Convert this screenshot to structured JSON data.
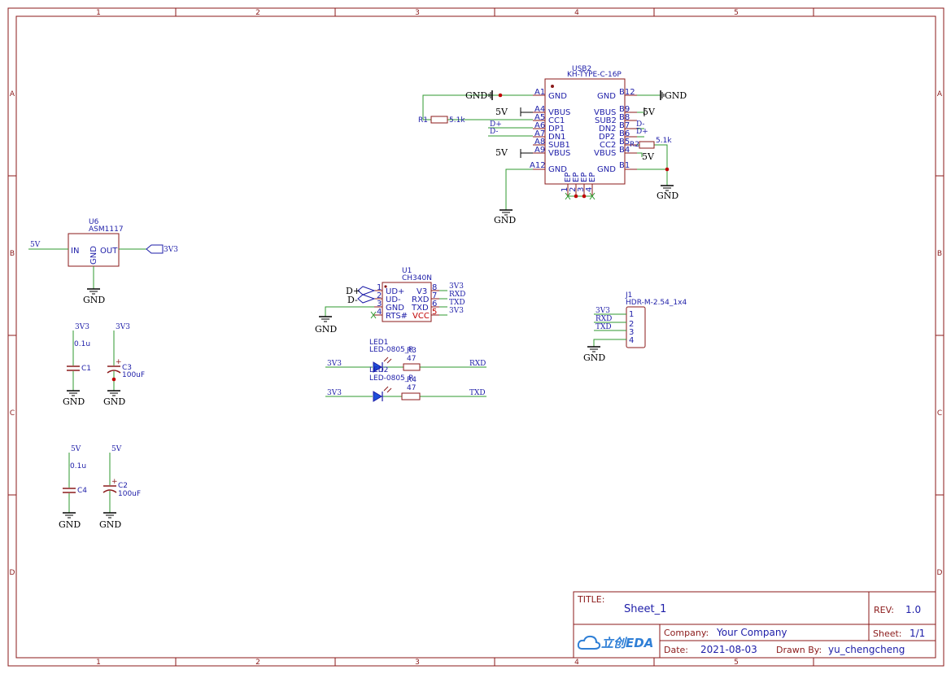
{
  "frame": {
    "columns": [
      "1",
      "2",
      "3",
      "4",
      "5"
    ],
    "rows": [
      "A",
      "B",
      "C",
      "D"
    ]
  },
  "usb2": {
    "ref": "USB2",
    "value": "KH-TYPE-C-16P",
    "left_pins": [
      {
        "num": "A1",
        "name": "GND"
      },
      {
        "num": "A4",
        "name": "VBUS"
      },
      {
        "num": "A5",
        "name": "CC1"
      },
      {
        "num": "A6",
        "name": "DP1"
      },
      {
        "num": "A7",
        "name": "DN1"
      },
      {
        "num": "A8",
        "name": "SUB1"
      },
      {
        "num": "A9",
        "name": "VBUS"
      },
      {
        "num": "A12",
        "name": "GND"
      }
    ],
    "right_pins": [
      {
        "num": "B12",
        "name": "GND"
      },
      {
        "num": "B9",
        "name": "VBUS"
      },
      {
        "num": "B8",
        "name": "SUB2"
      },
      {
        "num": "B7",
        "name": "DN2"
      },
      {
        "num": "B6",
        "name": "DP2"
      },
      {
        "num": "B5",
        "name": "CC2"
      },
      {
        "num": "B4",
        "name": "VBUS"
      },
      {
        "num": "B1",
        "name": "GND"
      }
    ],
    "bottom_pins": [
      "EP",
      "EP",
      "EP",
      "EP"
    ],
    "bottom_nums": [
      "1",
      "2",
      "3",
      "4"
    ]
  },
  "r1": {
    "ref": "R1",
    "value": "5.1k"
  },
  "r2": {
    "ref": "R2",
    "value": "5.1k"
  },
  "u6": {
    "ref": "U6",
    "value": "ASM1117",
    "pin_in": "IN",
    "pin_out": "OUT",
    "pin_gnd": "GND"
  },
  "u1": {
    "ref": "U1",
    "value": "CH340N",
    "left_pins": [
      {
        "num": "1",
        "name": "UD+"
      },
      {
        "num": "2",
        "name": "UD-"
      },
      {
        "num": "3",
        "name": "GND"
      },
      {
        "num": "4",
        "name": "RTS#"
      }
    ],
    "right_pins": [
      {
        "num": "8",
        "name": "V3"
      },
      {
        "num": "7",
        "name": "RXD"
      },
      {
        "num": "6",
        "name": "TXD"
      },
      {
        "num": "5",
        "name": "VCC"
      }
    ]
  },
  "j1": {
    "ref": "J1",
    "value": "HDR-M-2.54_1x4",
    "pins": [
      "1",
      "2",
      "3",
      "4"
    ]
  },
  "led1": {
    "ref": "LED1",
    "value": "LED-0805_R"
  },
  "led2": {
    "ref": "LED2",
    "value": "LED-0805_R"
  },
  "r3": {
    "ref": "R3",
    "value": "47"
  },
  "r4": {
    "ref": "R4",
    "value": "47"
  },
  "c1": {
    "ref": "C1",
    "value": "0.1u"
  },
  "c2": {
    "ref": "C2",
    "value": "100uF"
  },
  "c3": {
    "ref": "C3",
    "value": "100uF"
  },
  "c4": {
    "ref": "C4",
    "value": "0.1u"
  },
  "nets": {
    "gnd": "GND",
    "v5": "5V",
    "v33": "3V3",
    "dp": "D+",
    "dn": "D-",
    "rxd": "RXD",
    "txd": "TXD"
  },
  "title_block": {
    "title_label": "TITLE:",
    "title": "Sheet_1",
    "rev_label": "REV:",
    "rev": "1.0",
    "logo": "立创EDA",
    "company_label": "Company:",
    "company": "Your Company",
    "sheet_label": "Sheet:",
    "sheet": "1/1",
    "date_label": "Date:",
    "date": "2021-08-03",
    "drawn_label": "Drawn By:",
    "drawn_by": "yu_chengcheng"
  },
  "colors": {
    "frame": "#8b1a1a",
    "wire": "#2f9a2f",
    "pin_text": "#1d1da8",
    "junction": "#c00000",
    "ground": "#000000"
  }
}
